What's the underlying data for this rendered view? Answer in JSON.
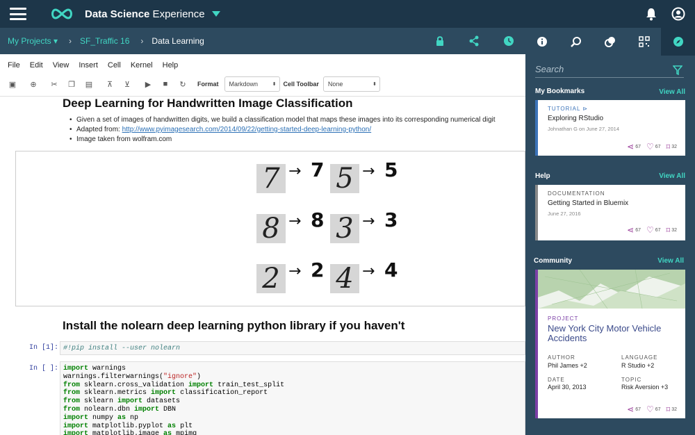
{
  "app": {
    "title_bold": "Data Science",
    "title_light": " Experience"
  },
  "breadcrumb": {
    "projects": "My Projects",
    "project": "SF_Traffic 16",
    "notebook": "Data Learning"
  },
  "menu": [
    "File",
    "Edit",
    "View",
    "Insert",
    "Cell",
    "Kernel",
    "Help"
  ],
  "toolbar": {
    "format_label": "Format",
    "format_value": "Markdown",
    "celltoolbar_label": "Cell Toolbar",
    "celltoolbar_value": "None"
  },
  "notebook": {
    "heading1": "Deep Learning for Handwritten Image Classification",
    "bullets": [
      "Given a set of images of handwritten digits, we build a classification model that maps these images into its corresponding numerical digit",
      "Adapted from: ",
      "Image taken from wolfram.com"
    ],
    "link": "http://www.pyimagesearch.com/2014/09/22/getting-started-deep-learning-python/",
    "digits": [
      "7",
      "5",
      "8",
      "3",
      "2",
      "4"
    ],
    "arrow": "→",
    "heading2": "Install the nolearn deep learning python library if you haven't",
    "cell1_prompt": "In [1]:",
    "cell1_code": "#!pip install --user nolearn",
    "cell2_prompt": "In [ ]:"
  },
  "sidebar": {
    "search_placeholder": "Search",
    "bookmarks": {
      "title": "My Bookmarks",
      "viewall": "View All",
      "tag": "TUTORIAL",
      "item": "Exploring RStudio",
      "meta": "Johnathan G on June 27, 2014",
      "shares": "67",
      "likes": "67",
      "saves": "32"
    },
    "help": {
      "title": "Help",
      "viewall": "View All",
      "tag": "DOCUMENTATION",
      "item": "Getting Started in Bluemix",
      "meta": "June 27, 2016",
      "shares": "67",
      "likes": "67",
      "saves": "32"
    },
    "community": {
      "title": "Community",
      "viewall": "View All",
      "tag": "PROJECT",
      "item": "New York City Motor Vehicle Accidents",
      "author_label": "AUTHOR",
      "author": "Phil James +2",
      "language_label": "LANGUAGE",
      "language": "R Studio +2",
      "date_label": "DATE",
      "date": "April 30, 2013",
      "topic_label": "TOPIC",
      "topic": "Risk Aversion +3",
      "shares": "67",
      "likes": "67",
      "saves": "32"
    }
  },
  "colors": {
    "topbar": "#1d3649",
    "subbar": "#2d4a5f",
    "accent": "#41d6c3",
    "project_accent": "#7b3fa6"
  }
}
